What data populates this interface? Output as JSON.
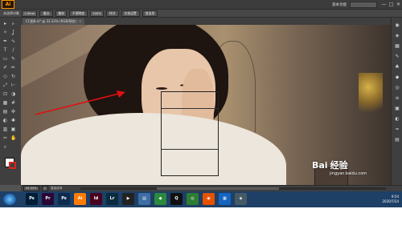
{
  "menubar": {
    "logo": "Ai",
    "workspace": "基本功能",
    "window_controls": [
      "—",
      "□",
      "✕"
    ]
  },
  "control_bar": {
    "items": [
      {
        "type": "text",
        "label": "未选择对象"
      },
      {
        "type": "field",
        "label": "1.9mm"
      },
      {
        "type": "button",
        "label": "描边:"
      },
      {
        "type": "field",
        "label": "基本"
      },
      {
        "type": "button",
        "label": "不透明度"
      },
      {
        "type": "field",
        "label": "100%"
      },
      {
        "type": "button",
        "label": "样式"
      },
      {
        "type": "button",
        "label": "文档设置"
      },
      {
        "type": "button",
        "label": "首选项"
      }
    ]
  },
  "document": {
    "tab_label": "CC图8.ai* @ 33.33% (RGB/预览)",
    "close_glyph": "✕"
  },
  "tools": {
    "icons": [
      "selection-tool",
      "direct-selection-tool",
      "magic-wand-tool",
      "lasso-tool",
      "pen-tool",
      "curvature-tool",
      "type-tool",
      "line-tool",
      "rectangle-tool",
      "paintbrush-tool",
      "shaper-tool",
      "pencil-tool",
      "eraser-tool",
      "rotate-tool",
      "scale-tool",
      "width-tool",
      "free-transform-tool",
      "shape-builder-tool",
      "perspective-tool",
      "mesh-tool",
      "gradient-tool",
      "eyedropper-tool",
      "blend-tool",
      "symbol-sprayer-tool",
      "column-graph-tool",
      "artboard-tool",
      "slice-tool",
      "hand-tool",
      "zoom-tool"
    ],
    "glyphs": [
      "▸",
      "▹",
      "✧",
      "ʆ",
      "✒",
      "∿",
      "T",
      "/",
      "▭",
      "✎",
      "✐",
      "✏",
      "◇",
      "↻",
      "⤢",
      "⊢",
      "⊡",
      "◑",
      "▦",
      "#",
      "▤",
      "✜",
      "◐",
      "✱",
      "▥",
      "▣",
      "✂",
      "✋",
      "⌕"
    ]
  },
  "right_panel": {
    "icons": [
      "color-icon",
      "color-guide-icon",
      "swatches-icon",
      "brushes-icon",
      "symbols-icon",
      "graphic-styles-icon",
      "appearance-icon",
      "layers-icon",
      "artboards-icon",
      "transparency-icon",
      "stroke-icon",
      "gradient-icon"
    ],
    "glyphs": [
      "◉",
      "◈",
      "▦",
      "✎",
      "♣",
      "◆",
      "◎",
      "≡",
      "▣",
      "◐",
      "═",
      "▤"
    ]
  },
  "status_bar": {
    "zoom": "33.33%",
    "artboard_number": "1",
    "tool_status": "直接选择"
  },
  "watermark": {
    "brand_part1": "Bai",
    "brand_part2": "经验",
    "url": "jingyan.baidu.com"
  },
  "taskbar": {
    "apps": [
      {
        "name": "start-orb",
        "label": ""
      },
      {
        "name": "photoshop",
        "label": "Ps",
        "color": "#001e36"
      },
      {
        "name": "premiere",
        "label": "Pr",
        "color": "#2a0634"
      },
      {
        "name": "photoshop-2",
        "label": "Ps",
        "color": "#0c2b4f"
      },
      {
        "name": "illustrator",
        "label": "Ai",
        "color": "#ff7c00"
      },
      {
        "name": "indesign",
        "label": "Id",
        "color": "#49021f"
      },
      {
        "name": "lightroom",
        "label": "Lr",
        "color": "#0b2b3f"
      },
      {
        "name": "media-player",
        "label": "▶",
        "color": "#222"
      },
      {
        "name": "folder",
        "label": "▤",
        "color": "#3d6ea3"
      },
      {
        "name": "app-green",
        "label": "◆",
        "color": "#2b8a3e"
      },
      {
        "name": "qq",
        "label": "Q",
        "color": "#111"
      },
      {
        "name": "chrome",
        "label": "◎",
        "color": "#2e7d32"
      },
      {
        "name": "firefox",
        "label": "◉",
        "color": "#e65100"
      },
      {
        "name": "explorer",
        "label": "▦",
        "color": "#1565c0"
      },
      {
        "name": "app-misc",
        "label": "◈",
        "color": "#455a64"
      }
    ],
    "time": "9:54",
    "date": "2020/7/24"
  }
}
